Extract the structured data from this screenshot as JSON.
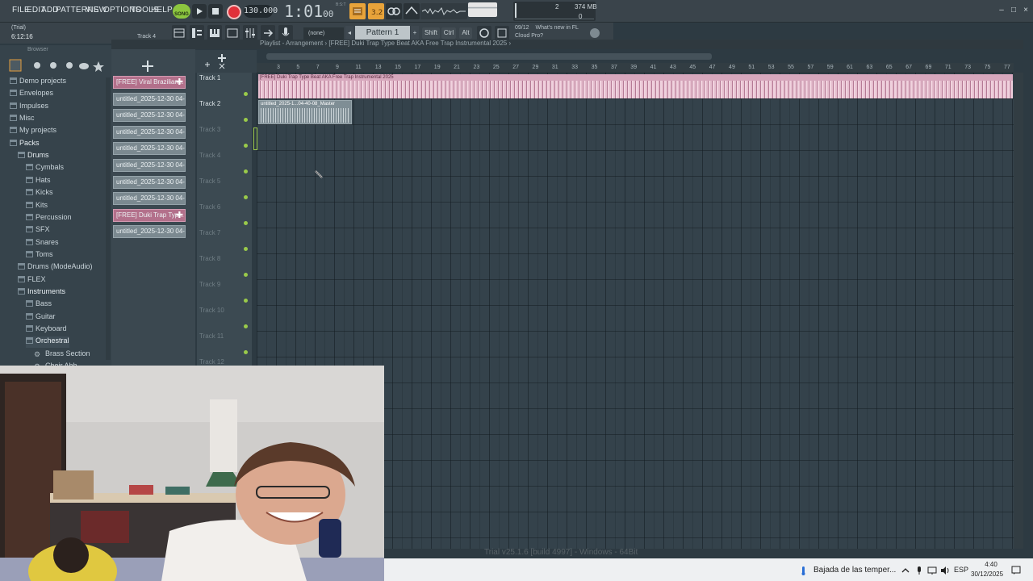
{
  "menu": [
    "FILE",
    "EDIT",
    "ADD",
    "PATTERNS",
    "VIEW",
    "OPTIONS",
    "TOOLS",
    "HELP"
  ],
  "transport": {
    "mode_label": "SONG",
    "tempo": "130.000",
    "time_main": "1:01",
    "time_small": "00",
    "time_unit": "B:S:T"
  },
  "cpu_meter": {
    "cpu": "2",
    "memory": "374 MB",
    "polyphony": "0"
  },
  "project": {
    "status": "(Trial)",
    "time": "6:12:16",
    "hint": "Track 4"
  },
  "toolbar2": {
    "snap": "(none)",
    "pattern": "Pattern 1",
    "modifiers": [
      "Shift",
      "Ctrl",
      "Alt"
    ],
    "news_date": "09/12",
    "news_line1": "What's new in FL",
    "news_line2": "Cloud Pro?"
  },
  "browser": {
    "title": "Browser",
    "items": [
      {
        "label": "Demo projects",
        "indent": 0
      },
      {
        "label": "Envelopes",
        "indent": 0
      },
      {
        "label": "Impulses",
        "indent": 0
      },
      {
        "label": "Misc",
        "indent": 0
      },
      {
        "label": "My projects",
        "indent": 0
      },
      {
        "label": "Packs",
        "indent": 0
      },
      {
        "label": "Drums",
        "indent": 1
      },
      {
        "label": "Cymbals",
        "indent": 2
      },
      {
        "label": "Hats",
        "indent": 2
      },
      {
        "label": "Kicks",
        "indent": 2
      },
      {
        "label": "Kits",
        "indent": 2
      },
      {
        "label": "Percussion",
        "indent": 2
      },
      {
        "label": "SFX",
        "indent": 2
      },
      {
        "label": "Snares",
        "indent": 2
      },
      {
        "label": "Toms",
        "indent": 2
      },
      {
        "label": "Drums (ModeAudio)",
        "indent": 1
      },
      {
        "label": "FLEX",
        "indent": 1
      },
      {
        "label": "Instruments",
        "indent": 1
      },
      {
        "label": "Bass",
        "indent": 2
      },
      {
        "label": "Guitar",
        "indent": 2
      },
      {
        "label": "Keyboard",
        "indent": 2
      },
      {
        "label": "Orchestral",
        "indent": 2
      },
      {
        "label": "Brass Section",
        "indent": 3
      },
      {
        "label": "Choir Ahh",
        "indent": 3
      }
    ]
  },
  "picker": [
    "[FREE] Viral Brazilian...",
    "untitled_2025-12-30 04-...",
    "untitled_2025-12-30 04-...",
    "untitled_2025-12-30 04-...",
    "untitled_2025-12-30 04-...",
    "untitled_2025-12-30 04-...",
    "untitled_2025-12-30 04-...",
    "untitled_2025-12-30 04-...",
    "[FREE] Duki Trap Typ...",
    "untitled_2025-12-30 04-..."
  ],
  "playlist": {
    "title": "Playlist - Arrangement › [FREE] Duki Trap Type Beat AKA  Free Trap Instrumental 2025 ›",
    "tracks": [
      "Track 1",
      "Track 2",
      "Track 3",
      "Track 4",
      "Track 5",
      "Track 6",
      "Track 7",
      "Track 8",
      "Track 9",
      "Track 10",
      "Track 11",
      "Track 12"
    ],
    "bars": [
      "3",
      "5",
      "7",
      "9",
      "11",
      "13",
      "15",
      "17",
      "19",
      "21",
      "23",
      "25",
      "27",
      "29",
      "31",
      "33",
      "35",
      "37",
      "39",
      "41",
      "43",
      "45",
      "47",
      "49",
      "51",
      "53",
      "55",
      "57",
      "59",
      "61",
      "63",
      "65",
      "67",
      "69",
      "71",
      "73",
      "75",
      "77"
    ],
    "clip1": "[FREE] Duki Trap Type Beat AKA  Free Trap Instrumental 2025",
    "clip2": "untitled_2025-1...04-40-08_Master"
  },
  "taskbar": {
    "faded_text": "Trial v25.1.6 [build 4997] - Windows - 64Bit",
    "weather": "Bajada de las temper...",
    "lang": "ESP",
    "time": "4:40",
    "date": "30/12/2025"
  },
  "colors": {
    "accent_green": "#8cc63f",
    "record_red": "#e0303a",
    "clip_pink": "#d7a8bd",
    "grid_bg": "#34424b"
  }
}
